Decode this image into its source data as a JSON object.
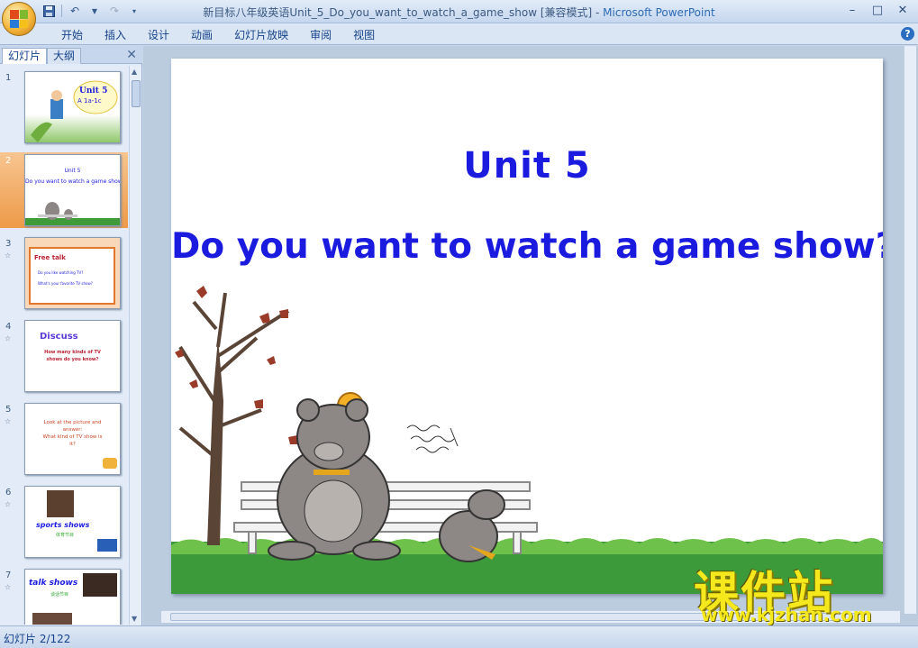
{
  "window": {
    "title_file": "新目标八年级英语Unit_5_Do_you_want_to_watch_a_game_show [兼容模式]",
    "title_sep": " - ",
    "title_app": "Microsoft PowerPoint"
  },
  "ribbon": {
    "tabs": [
      "开始",
      "插入",
      "设计",
      "动画",
      "幻灯片放映",
      "审阅",
      "视图"
    ]
  },
  "left_pane": {
    "tab_slides": "幻灯片",
    "tab_outline": "大纲",
    "thumbnails": [
      {
        "num": "1",
        "lines": [
          "Unit 5",
          "A 1a-1c"
        ]
      },
      {
        "num": "2",
        "lines": [
          "Unit 5",
          "Do you want to watch a game show?"
        ]
      },
      {
        "num": "3",
        "lines": [
          "Free talk",
          "Do you like watching TV?",
          "What's your favorite TV show?"
        ]
      },
      {
        "num": "4",
        "lines": [
          "Discuss",
          "How many kinds of TV",
          "shows do you know?"
        ]
      },
      {
        "num": "5",
        "lines": [
          "Look at the picture and",
          "answer:",
          "What kind of TV show is",
          "it?"
        ]
      },
      {
        "num": "6",
        "lines": [
          "sports shows",
          "体育节目"
        ]
      },
      {
        "num": "7",
        "lines": [
          "talk shows",
          "谈话节目"
        ]
      }
    ]
  },
  "slide": {
    "title": "Unit 5",
    "subtitle": "Do you want to watch a game show?"
  },
  "watermark": {
    "cn": "课件站",
    "url": "www.kjzhan.com"
  },
  "status": {
    "text": "幻灯片 2/122"
  },
  "colors": {
    "slide_text": "#1b1be0",
    "selected_thumb": "#ee9a48",
    "watermark": "#f5e81c"
  }
}
